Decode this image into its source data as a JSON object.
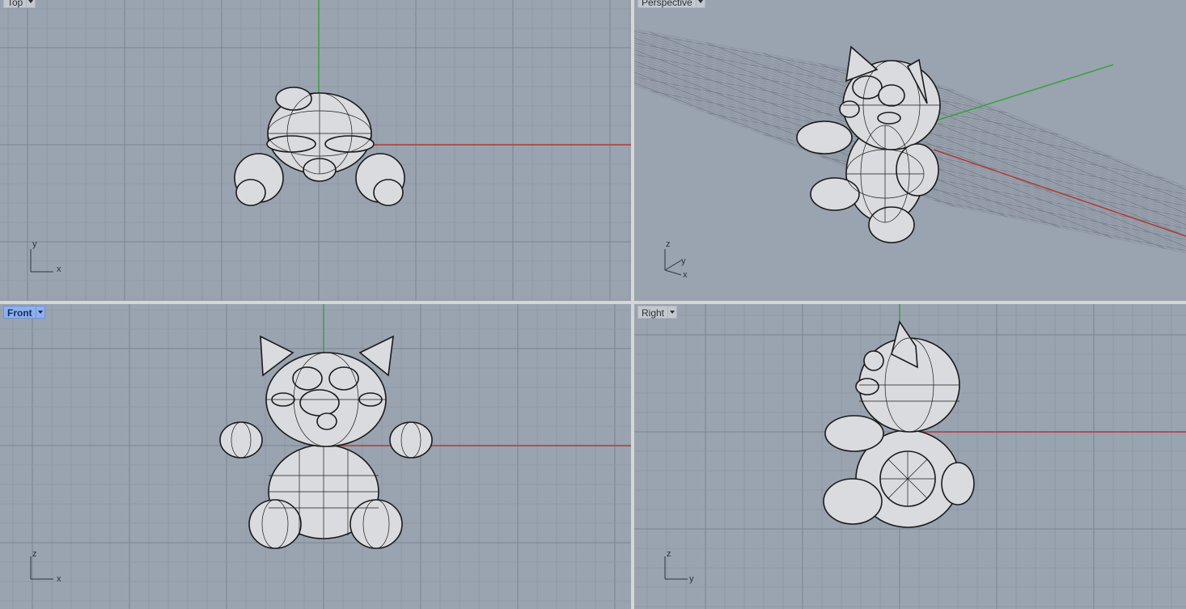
{
  "colors": {
    "viewport_bg": "#9aa3b0",
    "grid_minor": "#8c949f",
    "grid_major": "#7b838e",
    "axis_x": "#b03a32",
    "axis_y": "#37a33a",
    "active_title_bg": "#8fb0ea",
    "model_fill": "#d9dbde",
    "model_stroke": "#1a1a1a"
  },
  "viewports": {
    "top": {
      "title": "Top",
      "active": false,
      "axis_icon": {
        "vertical": "y",
        "horizontal": "x"
      }
    },
    "perspective": {
      "title": "Perspective",
      "active": false,
      "axis_icon": {
        "vertical": "z",
        "mid": "y",
        "horizontal": "x"
      }
    },
    "front": {
      "title": "Front",
      "active": true,
      "axis_icon": {
        "vertical": "z",
        "horizontal": "x"
      }
    },
    "right": {
      "title": "Right",
      "active": false,
      "axis_icon": {
        "vertical": "z",
        "horizontal": "y"
      }
    }
  },
  "icons": {
    "dropdown": "chevron-down-icon",
    "axis": "axis-widget-icon"
  }
}
